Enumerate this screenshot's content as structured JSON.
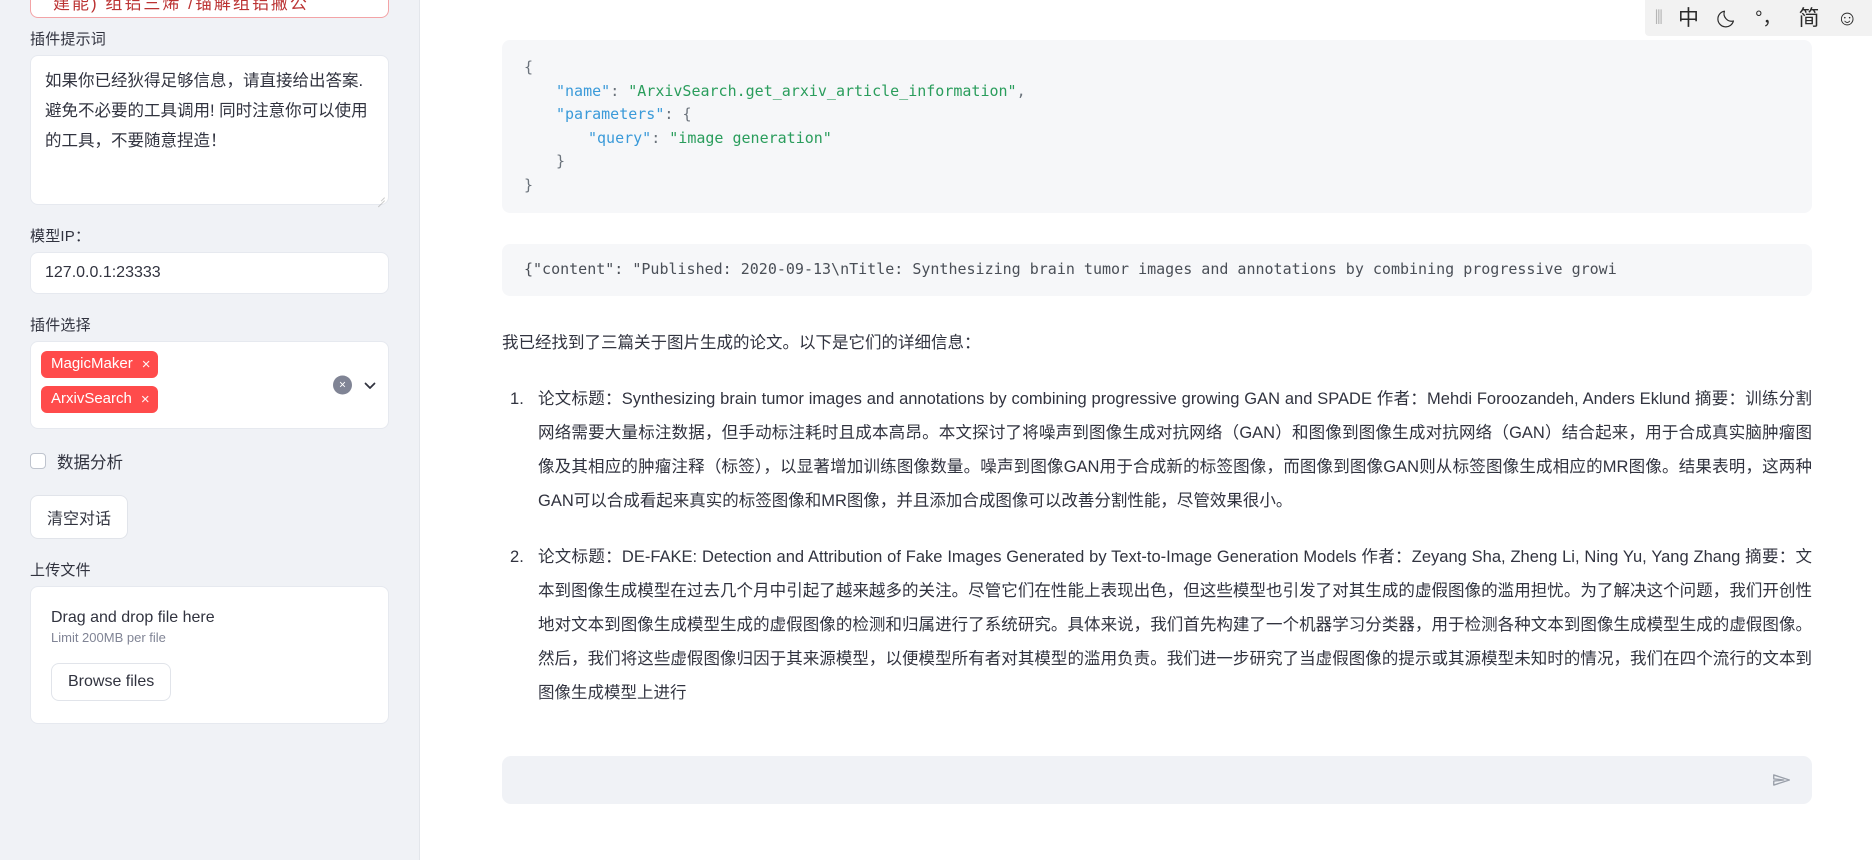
{
  "sidebar": {
    "clipped_top_text": "建能)  组铝三烯 /锚解组铝撇公",
    "prompt_label": "插件提示词",
    "prompt_value": "如果你已经狄得足够信息，请直接给出答案. 避免不必要的工具调用! 同时注意你可以使用的工具，不要随意捏造！",
    "model_ip_label": "模型IP：",
    "model_ip_value": "127.0.0.1:23333",
    "plugin_label": "插件选择",
    "plugin_tags": [
      {
        "label": "MagicMaker",
        "remove": "×"
      },
      {
        "label": "ArxivSearch",
        "remove": "×"
      }
    ],
    "multiselect_clear": "×",
    "checkbox_label": "数据分析",
    "clear_chat_button": "清空对话",
    "upload_label": "上传文件",
    "dropzone_title": "Drag and drop file here",
    "dropzone_limit": "Limit 200MB per file",
    "browse_button": "Browse files"
  },
  "ime": {
    "grip": "⦀",
    "lang": "中",
    "mode_icon": "moon-icon",
    "punct": "°，",
    "script": "简",
    "emoji": "☺"
  },
  "main": {
    "code_block_1": {
      "line1": "{",
      "line2_key": "\"name\"",
      "line2_sep": ": ",
      "line2_val": "\"ArxivSearch.get_arxiv_article_information\"",
      "line2_tail": ",",
      "line3_key": "\"parameters\"",
      "line3_sep": ": ",
      "line3_tail": "{",
      "line4_key": "\"query\"",
      "line4_sep": ": ",
      "line4_val": "\"image generation\"",
      "line5": "}",
      "line6": "}"
    },
    "code_block_2": "{\"content\": \"Published: 2020-09-13\\nTitle: Synthesizing brain tumor images and annotations by combining progressive growi",
    "intro": "我已经找到了三篇关于图片生成的论文。以下是它们的详细信息：",
    "papers": [
      "论文标题：Synthesizing brain tumor images and annotations by combining progressive growing GAN and SPADE 作者：Mehdi Foroozandeh, Anders Eklund 摘要：训练分割网络需要大量标注数据，但手动标注耗时且成本高昂。本文探讨了将噪声到图像生成对抗网络（GAN）和图像到图像生成对抗网络（GAN）结合起来，用于合成真实脑肿瘤图像及其相应的肿瘤注释（标签），以显著增加训练图像数量。噪声到图像GAN用于合成新的标签图像，而图像到图像GAN则从标签图像生成相应的MR图像。结果表明，这两种GAN可以合成看起来真实的标签图像和MR图像，并且添加合成图像可以改善分割性能，尽管效果很小。",
      "论文标题：DE-FAKE: Detection and Attribution of Fake Images Generated by Text-to-Image Generation Models 作者：Zeyang Sha, Zheng Li, Ning Yu, Yang Zhang 摘要：文本到图像生成模型在过去几个月中引起了越来越多的关注。尽管它们在性能上表现出色，但这些模型也引发了对其生成的虚假图像的滥用担忧。为了解决这个问题，我们开创性地对文本到图像生成模型生成的虚假图像的检测和归属进行了系统研究。具体来说，我们首先构建了一个机器学习分类器，用于检测各种文本到图像生成模型生成的虚假图像。然后，我们将这些虚假图像归因于其来源模型，以便模型所有者对其模型的滥用负责。我们进一步研究了当虚假图像的提示或其源模型未知时的情况，我们在四个流行的文本到图像生成模型上进行"
    ],
    "chat_placeholder": "",
    "send_icon": "send-icon"
  },
  "colors": {
    "accent_red": "#ff4b4b",
    "sidebar_bg": "#f0f2f6",
    "code_bg": "#f6f7f9",
    "string_green": "#2a9d5c",
    "key_blue": "#3a9ad9"
  }
}
